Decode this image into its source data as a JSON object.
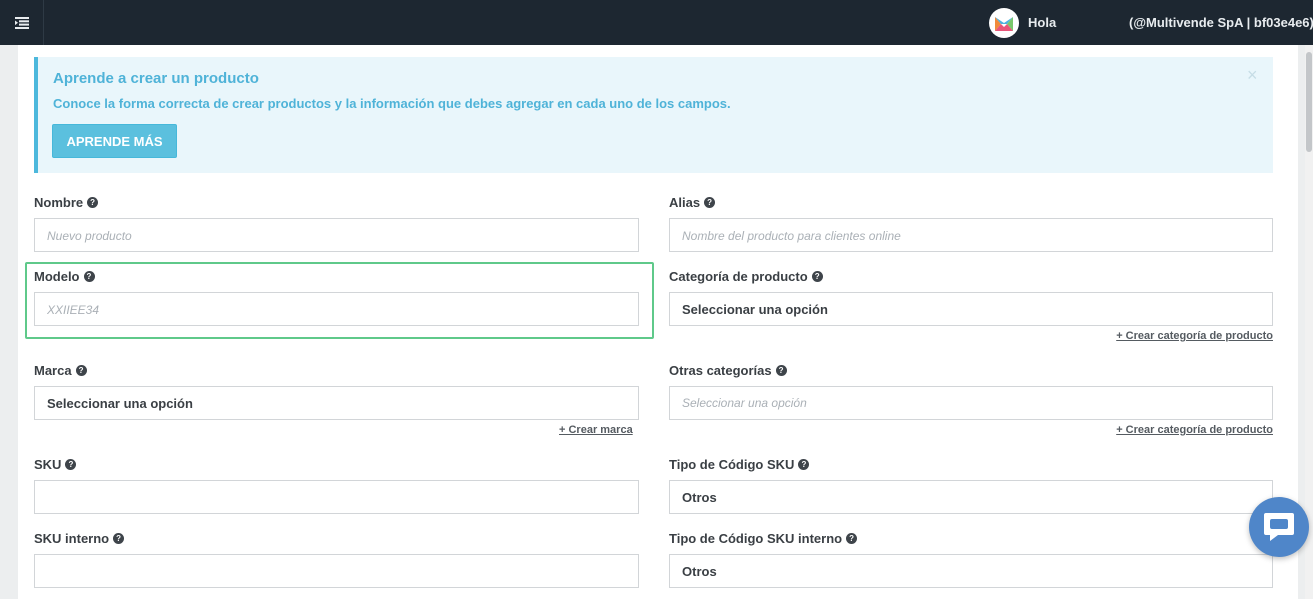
{
  "header": {
    "greeting": "Hola",
    "account": "(@Multivende SpA | bf03e4e6)"
  },
  "notice": {
    "title": "Aprende a crear un producto",
    "text": "Conoce la forma correcta de crear productos y la información que debes agregar en cada uno de los campos.",
    "button": "APRENDE MÁS",
    "close": "×"
  },
  "form": {
    "nombre": {
      "label": "Nombre",
      "placeholder": "Nuevo producto"
    },
    "alias": {
      "label": "Alias",
      "placeholder": "Nombre del producto para clientes online"
    },
    "modelo": {
      "label": "Modelo",
      "placeholder": "XXIIEE34"
    },
    "categoria": {
      "label": "Categoría de producto",
      "value": "Seleccionar una opción",
      "link": "+ Crear categoría de producto"
    },
    "marca": {
      "label": "Marca",
      "value": "Seleccionar una opción",
      "link": "+ Crear marca"
    },
    "otras_categorias": {
      "label": "Otras categorías",
      "placeholder": "Seleccionar una opción",
      "link": "+ Crear categoría de producto"
    },
    "sku": {
      "label": "SKU",
      "value": ""
    },
    "tipo_sku": {
      "label": "Tipo de Código SKU",
      "value": "Otros"
    },
    "sku_interno": {
      "label": "SKU interno",
      "value": ""
    },
    "tipo_sku_interno": {
      "label": "Tipo de Código SKU interno",
      "value": "Otros"
    }
  },
  "colors": {
    "topbar": "#1d2731",
    "accent": "#5bc0de",
    "highlight": "#5fc98a",
    "chat": "#4f86c9"
  },
  "icons": {
    "menu": "menu-toggle-icon",
    "help": "question-circle-icon",
    "chat": "chat-bubble-icon",
    "logo": "multivende-logo-icon"
  }
}
